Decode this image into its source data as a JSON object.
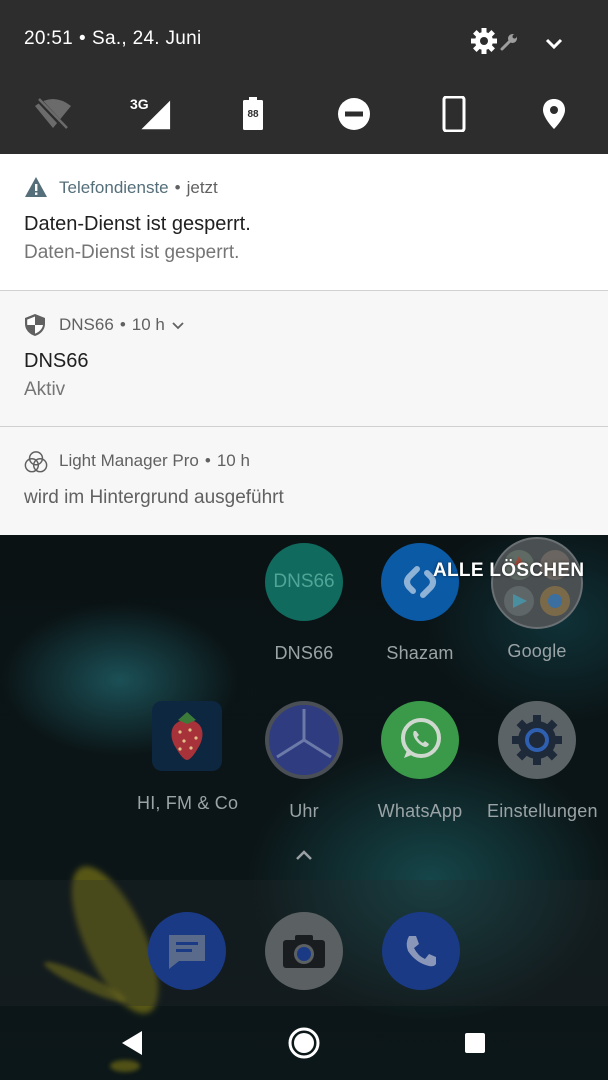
{
  "status_bar": {
    "time": "20:51",
    "separator": "•",
    "date": "Sa., 24. Juni",
    "battery_level": "88",
    "network_type": "3G",
    "icons": [
      "settings-gear-icon",
      "wrench-icon",
      "expand-chevron-icon"
    ]
  },
  "quick_settings": [
    {
      "name": "wifi-off-icon"
    },
    {
      "name": "mobile-signal-3g-icon"
    },
    {
      "name": "battery-icon"
    },
    {
      "name": "do-not-disturb-icon"
    },
    {
      "name": "rotation-lock-icon"
    },
    {
      "name": "location-icon"
    }
  ],
  "notifications": [
    {
      "app": "Telefondienste",
      "time": "jetzt",
      "title": "Daten-Dienst ist gesperrt.",
      "text": "Daten-Dienst ist gesperrt.",
      "icon": "warning-icon"
    },
    {
      "app": "DNS66",
      "time": "10 h",
      "title": "DNS66",
      "text": "Aktiv",
      "icon": "shield-icon"
    },
    {
      "app": "Light Manager Pro",
      "time": "10 h",
      "text": "wird im Hintergrund ausgeführt",
      "icon": "light-manager-icon"
    }
  ],
  "clear_all_label": "ALLE LÖSCHEN",
  "home_apps": {
    "dns66": {
      "label": "DNS66",
      "icon_text": "DNS66"
    },
    "shazam": {
      "label": "Shazam"
    },
    "google": {
      "label": "Google"
    },
    "hifm": {
      "label": "HI, FM & Co"
    },
    "uhr": {
      "label": "Uhr"
    },
    "whatsapp": {
      "label": "WhatsApp"
    },
    "settings": {
      "label": "Einstellungen"
    }
  },
  "dock": [
    "messages-icon",
    "camera-icon",
    "phone-icon"
  ],
  "nav": [
    "back-icon",
    "home-icon",
    "recents-icon"
  ],
  "colors": {
    "status_bar_bg": "#2d2d2d",
    "notification_bg": "#ffffff",
    "accent": "#116a5e"
  }
}
